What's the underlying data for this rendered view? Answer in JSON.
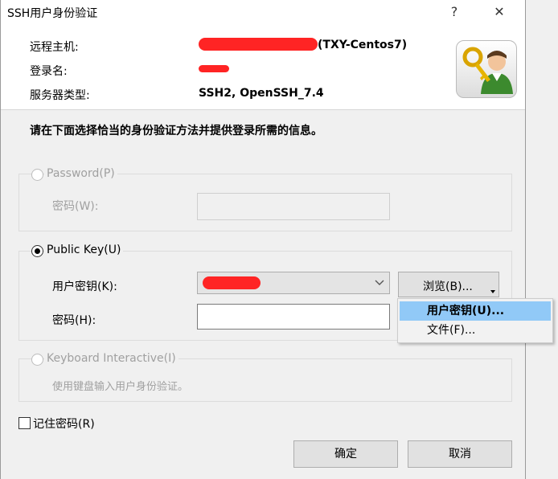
{
  "window": {
    "title": "SSH用户身份验证",
    "help_label": "?",
    "close_label": "✕"
  },
  "info": {
    "remote_host_label": "远程主机:",
    "remote_host_suffix": "(TXY-Centos7)",
    "login_label": "登录名:",
    "server_type_label": "服务器类型:",
    "server_type_value": "SSH2, OpenSSH_7.4",
    "redaction_color": "#ff2424"
  },
  "instruction": "请在下面选择恰当的身份验证方法并提供登录所需的信息。",
  "password_group": {
    "radio_label": "Password(P)",
    "field_label": "密码(W):",
    "selected": false,
    "enabled": false
  },
  "publickey_group": {
    "radio_label": "Public Key(U)",
    "selected": true,
    "key_label": "用户密钥(K):",
    "key_dropdown_icon": "chevron-down-icon",
    "passphrase_label": "密码(H):",
    "browse_label": "浏览(B)...",
    "browse_menu_icon": "dropdown-arrow-icon"
  },
  "browse_menu": {
    "items": [
      "用户密钥(U)...",
      "文件(F)..."
    ],
    "highlighted_index": 0,
    "highlight_color": "#91c9f7"
  },
  "keyboard_group": {
    "radio_label": "Keyboard Interactive(I)",
    "desc": "使用键盘输入用户身份验证。",
    "selected": false,
    "enabled": false
  },
  "remember_password": {
    "label": "记住密码(R)",
    "checked": false
  },
  "buttons": {
    "ok": "确定",
    "cancel": "取消"
  }
}
